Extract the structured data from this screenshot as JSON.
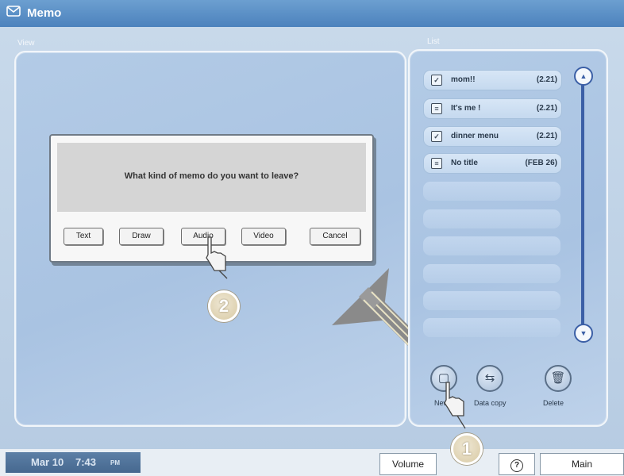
{
  "app": {
    "title": "Memo",
    "title_icon": "envelope-icon"
  },
  "view_panel": {
    "label": "View"
  },
  "list_panel": {
    "label": "List"
  },
  "dialog": {
    "question": "What kind of memo do you want to leave?",
    "buttons": [
      "Text",
      "Draw",
      "Audio",
      "Video",
      "Cancel"
    ]
  },
  "list": {
    "items": [
      {
        "title": "mom!!",
        "date": "(2.21)",
        "icon": "checked-memo-icon"
      },
      {
        "title": "It's me !",
        "date": "(2.21)",
        "icon": "memo-icon"
      },
      {
        "title": "dinner menu",
        "date": "(2.21)",
        "icon": "checked-memo-icon"
      },
      {
        "title": "No title",
        "date": "(FEB 26)",
        "icon": "memo-icon"
      }
    ]
  },
  "actions": {
    "new": "New",
    "data_copy": "Data copy",
    "delete": "Delete"
  },
  "status": {
    "date": "Mar 10",
    "time": "7:43",
    "ampm": "PM",
    "volume": "Volume",
    "help": "?",
    "main": "Main"
  },
  "callouts": {
    "step1": "1",
    "step2": "2"
  },
  "colors": {
    "title_bar": "#5b8fc7",
    "panel_bg": "#aec7e4",
    "scroll_accent": "#3b5fa6",
    "status_date_bg": "#4f7299"
  }
}
